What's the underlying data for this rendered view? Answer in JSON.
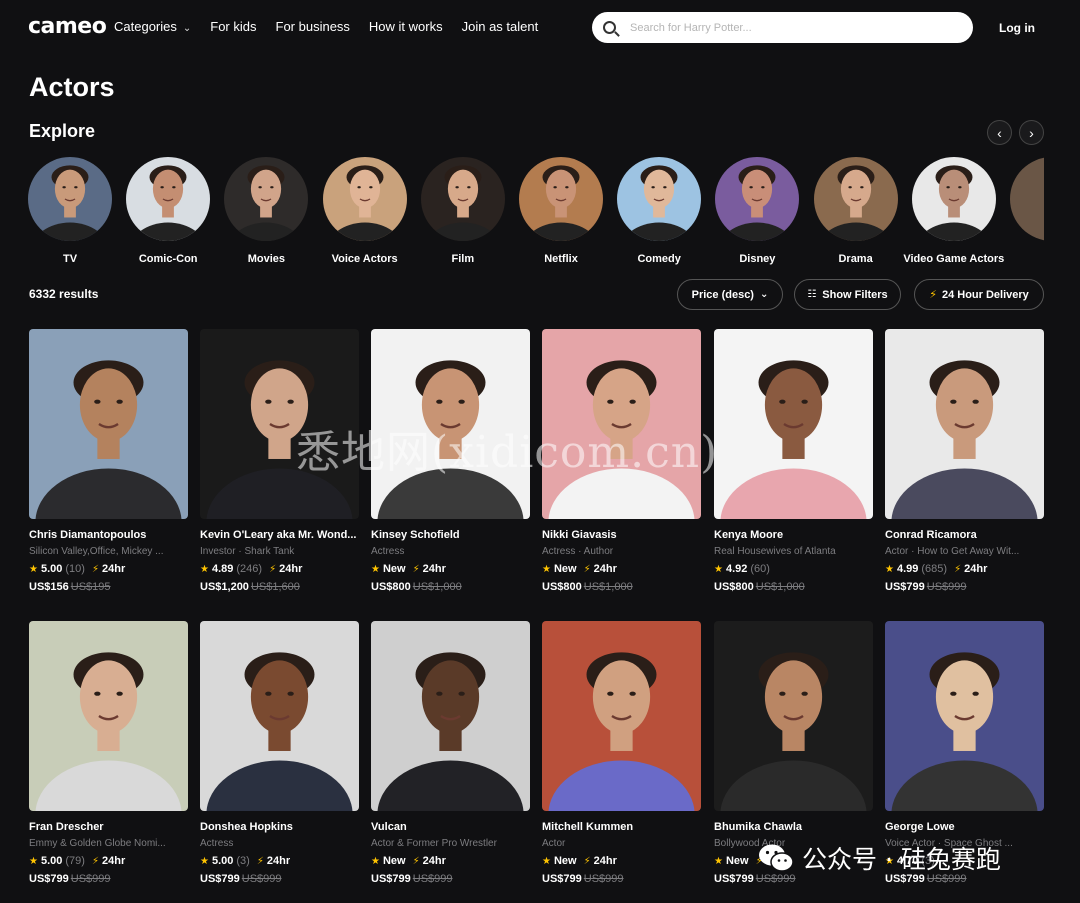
{
  "nav": {
    "logo": "cameo",
    "links": [
      "Categories",
      "For kids",
      "For business",
      "How it works",
      "Join as talent"
    ],
    "search_placeholder": "Search for Harry Potter...",
    "login": "Log in"
  },
  "page_title": "Actors",
  "explore_title": "Explore",
  "categories": [
    {
      "label": "TV",
      "bg": "#5a6b86",
      "skin": "#c99a7a"
    },
    {
      "label": "Comic-Con",
      "bg": "#d8dde2",
      "skin": "#c48e72"
    },
    {
      "label": "Movies",
      "bg": "#2e2b2a",
      "skin": "#d1a48a"
    },
    {
      "label": "Voice Actors",
      "bg": "#c9a27c",
      "skin": "#e0b496"
    },
    {
      "label": "Film",
      "bg": "#2a2320",
      "skin": "#d7a98a"
    },
    {
      "label": "Netflix",
      "bg": "#b37c4f",
      "skin": "#c99376"
    },
    {
      "label": "Comedy",
      "bg": "#9dc3e2",
      "skin": "#e0b89a"
    },
    {
      "label": "Disney",
      "bg": "#7a5c9e",
      "skin": "#c98e78"
    },
    {
      "label": "Drama",
      "bg": "#8a6a4e",
      "skin": "#d6a98c"
    },
    {
      "label": "Video Game Actors",
      "bg": "#e8e8e8",
      "skin": "#b98e78"
    }
  ],
  "results_count": "6332 results",
  "filters": {
    "sort": "Price (desc)",
    "show_filters": "Show Filters",
    "delivery": "24 Hour Delivery"
  },
  "talent": [
    {
      "name": "Chris Diamantopoulos",
      "role": "Silicon Valley,Office, Mickey ...",
      "score": "5.00",
      "count": "(10)",
      "speed": "24hr",
      "price": "US$156",
      "orig": "US$195",
      "bg": "#8aa0b8",
      "skin": "#b4825e",
      "shirt": "#2b2b2e"
    },
    {
      "name": "Kevin O'Leary aka Mr. Wond...",
      "role": "Investor · Shark Tank",
      "score": "4.89",
      "count": "(246)",
      "speed": "24hr",
      "price": "US$1,200",
      "orig": "US$1,600",
      "bg": "#1a1a1a",
      "skin": "#d0a58a",
      "shirt": "#1f1f24"
    },
    {
      "name": "Kinsey Schofield",
      "role": "Actress",
      "score": "New",
      "count": "",
      "speed": "24hr",
      "price": "US$800",
      "orig": "US$1,000",
      "bg": "#f2f2f2",
      "skin": "#c89474",
      "shirt": "#3a3a3a"
    },
    {
      "name": "Nikki Giavasis",
      "role": "Actress · Author",
      "score": "New",
      "count": "",
      "speed": "24hr",
      "price": "US$800",
      "orig": "US$1,000",
      "bg": "#e5a5a8",
      "skin": "#d6a487",
      "shirt": "#f3f3f3"
    },
    {
      "name": "Kenya Moore",
      "role": "Real Housewives of Atlanta",
      "score": "4.92",
      "count": "(60)",
      "speed": "",
      "price": "US$800",
      "orig": "US$1,000",
      "bg": "#f4f4f4",
      "skin": "#8a5a40",
      "shirt": "#e8a6ae"
    },
    {
      "name": "Conrad Ricamora",
      "role": "Actor · How to Get Away Wit...",
      "score": "4.99",
      "count": "(685)",
      "speed": "24hr",
      "price": "US$799",
      "orig": "US$999",
      "bg": "#e9e9e9",
      "skin": "#c99a7c",
      "shirt": "#4a4a5e"
    },
    {
      "name": "Fran Drescher",
      "role": "Emmy & Golden Globe Nomi...",
      "score": "5.00",
      "count": "(79)",
      "speed": "24hr",
      "price": "US$799",
      "orig": "US$999",
      "bg": "#c8cdb8",
      "skin": "#d8ae92",
      "shirt": "#d9d9d9"
    },
    {
      "name": "Donshea Hopkins",
      "role": "Actress",
      "score": "5.00",
      "count": "(3)",
      "speed": "24hr",
      "price": "US$799",
      "orig": "US$999",
      "bg": "#d9d9d9",
      "skin": "#7a4a30",
      "shirt": "#2a3040"
    },
    {
      "name": "Vulcan",
      "role": "Actor & Former Pro Wrestler",
      "score": "New",
      "count": "",
      "speed": "24hr",
      "price": "US$799",
      "orig": "US$999",
      "bg": "#cfcfcf",
      "skin": "#5a3a28",
      "shirt": "#222226"
    },
    {
      "name": "Mitchell Kummen",
      "role": "Actor",
      "score": "New",
      "count": "",
      "speed": "24hr",
      "price": "US$799",
      "orig": "US$999",
      "bg": "#b8503a",
      "skin": "#d0a080",
      "shirt": "#6a6ac8"
    },
    {
      "name": "Bhumika Chawla",
      "role": "Bollywood Actor",
      "score": "New",
      "count": "",
      "speed": "24hr",
      "price": "US$799",
      "orig": "US$999",
      "bg": "#1c1c1c",
      "skin": "#b98664",
      "shirt": "#2a2a2a"
    },
    {
      "name": "George Lowe",
      "role": "Voice Actor · Space Ghost ...",
      "score": "4.70",
      "count": "(3)",
      "speed": "",
      "price": "US$799",
      "orig": "US$999",
      "bg": "#4a4e8a",
      "skin": "#e0c0a0",
      "shirt": "#333"
    }
  ],
  "watermark": "悉地网(xidicom.cn)",
  "wechat": "公众号 · 硅兔赛跑",
  "colors": {
    "background": "#101012",
    "accent": "#ffc400",
    "muted": "#7d7d80"
  }
}
